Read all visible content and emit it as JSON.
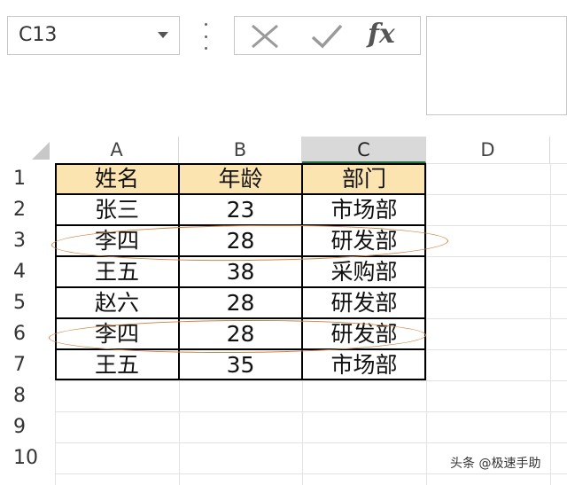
{
  "name_box": {
    "value": "C13"
  },
  "formula_bar": {
    "func_label": "fx",
    "value": ""
  },
  "columns": [
    {
      "label": "A",
      "selected": false
    },
    {
      "label": "B",
      "selected": false
    },
    {
      "label": "C",
      "selected": true
    },
    {
      "label": "D",
      "selected": false
    }
  ],
  "rows": [
    "1",
    "2",
    "3",
    "4",
    "5",
    "6",
    "7",
    "8",
    "9",
    "10"
  ],
  "table": {
    "header": [
      "姓名",
      "年龄",
      "部门"
    ],
    "data": [
      [
        "张三",
        "23",
        "市场部"
      ],
      [
        "李四",
        "28",
        "研发部"
      ],
      [
        "王五",
        "38",
        "采购部"
      ],
      [
        "赵六",
        "28",
        "研发部"
      ],
      [
        "李四",
        "28",
        "研发部"
      ],
      [
        "王五",
        "35",
        "市场部"
      ]
    ]
  },
  "highlight": {
    "color": "#d08040",
    "marked_rows": [
      "3",
      "6"
    ]
  },
  "colors": {
    "header_fill": "#fce4b0",
    "selected_column": "#d9d9d9"
  },
  "watermark": "头条 @极速手助"
}
